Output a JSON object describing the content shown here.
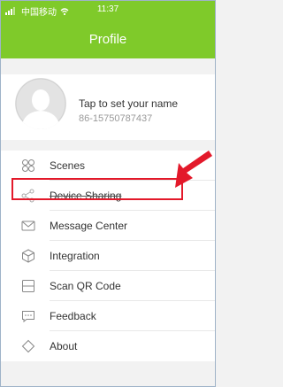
{
  "status_bar": {
    "carrier": "中国移动",
    "time": "11:37"
  },
  "header": {
    "title": "Profile"
  },
  "profile": {
    "name": "Tap to set your name",
    "phone": "86-15750787437"
  },
  "menu": {
    "items": [
      {
        "label": "Scenes",
        "icon": "scenes-icon"
      },
      {
        "label": "Device Sharing",
        "icon": "share-icon"
      },
      {
        "label": "Message Center",
        "icon": "message-icon"
      },
      {
        "label": "Integration",
        "icon": "integration-icon"
      },
      {
        "label": "Scan QR Code",
        "icon": "scan-icon"
      },
      {
        "label": "Feedback",
        "icon": "feedback-icon"
      },
      {
        "label": "About",
        "icon": "about-icon"
      }
    ]
  },
  "colors": {
    "accent": "#7fca2a",
    "annotation": "#e3192a"
  }
}
